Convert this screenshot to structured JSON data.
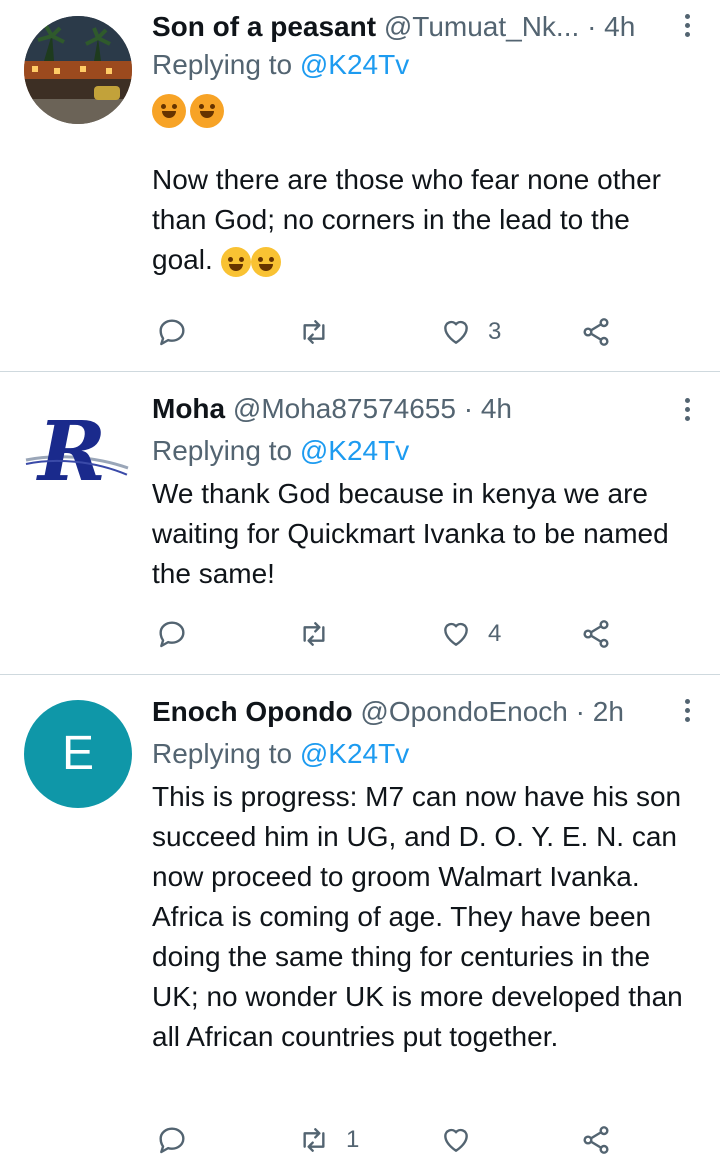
{
  "tweets": [
    {
      "name": "Son of a peasant",
      "handle": "@Tumuat_Nk...",
      "separator": "·",
      "time": "4h",
      "replying_prefix": "Replying to ",
      "replying_to": "@K24Tv",
      "text": "Now there are those who fear none other than God; no corners in the lead to the  goal.",
      "reply_count": "",
      "retweet_count": "",
      "like_count": "3"
    },
    {
      "name": "Moha",
      "handle": "@Moha87574655",
      "separator": "·",
      "time": "4h",
      "replying_prefix": "Replying to ",
      "replying_to": "@K24Tv",
      "text": "We thank God because in kenya we are waiting for Quickmart Ivanka to be named the same!",
      "reply_count": "",
      "retweet_count": "",
      "like_count": "4"
    },
    {
      "name": "Enoch Opondo",
      "handle": "@OpondoEnoch",
      "separator": "·",
      "time": "2h",
      "avatar_letter": "E",
      "replying_prefix": "Replying to ",
      "replying_to": "@K24Tv",
      "text": "This is progress: M7 can now have his son succeed him in UG, and D. O. Y. E. N. can now proceed to groom Walmart Ivanka. Africa is coming of age. They have been doing the same thing for centuries in the UK; no wonder UK is more developed than all African countries put together.",
      "reply_count": "",
      "retweet_count": "1",
      "like_count": ""
    }
  ],
  "icons": {
    "reply": "reply-icon",
    "retweet": "retweet-icon",
    "like": "heart-icon",
    "share": "share-icon",
    "more": "more-vertical-icon"
  },
  "colors": {
    "link": "#1d9bf0",
    "muted": "#536471",
    "divider": "#cfd9de",
    "avatar_e": "#0f97a8"
  }
}
